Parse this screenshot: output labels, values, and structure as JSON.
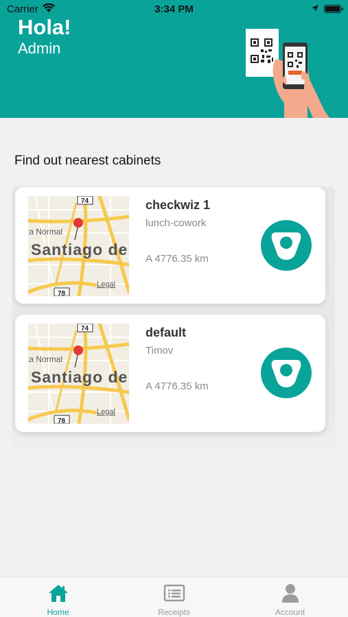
{
  "status_bar": {
    "carrier": "Carrier",
    "time": "3:34 PM"
  },
  "header": {
    "greeting": "Hola!",
    "user_name": "Admin"
  },
  "section_title": "Find out nearest cabinets",
  "cabinets": [
    {
      "name": "checkwiz 1",
      "subtitle": "lunch-cowork",
      "distance": "A 4776.35 km"
    },
    {
      "name": "default",
      "subtitle": "Timov",
      "distance": "A 4776.35 km"
    }
  ],
  "map": {
    "city_label": "Santiago de",
    "area_label": "ta Normal",
    "road_top": "74",
    "road_bottom": "78",
    "legal": "Legal"
  },
  "tabs": [
    {
      "label": "Home",
      "icon": "home-icon",
      "active": true
    },
    {
      "label": "Receipts",
      "icon": "receipt-icon",
      "active": false
    },
    {
      "label": "Account",
      "icon": "account-icon",
      "active": false
    }
  ],
  "colors": {
    "brand": "#0aa39a",
    "inactive": "#9b9b9b"
  }
}
